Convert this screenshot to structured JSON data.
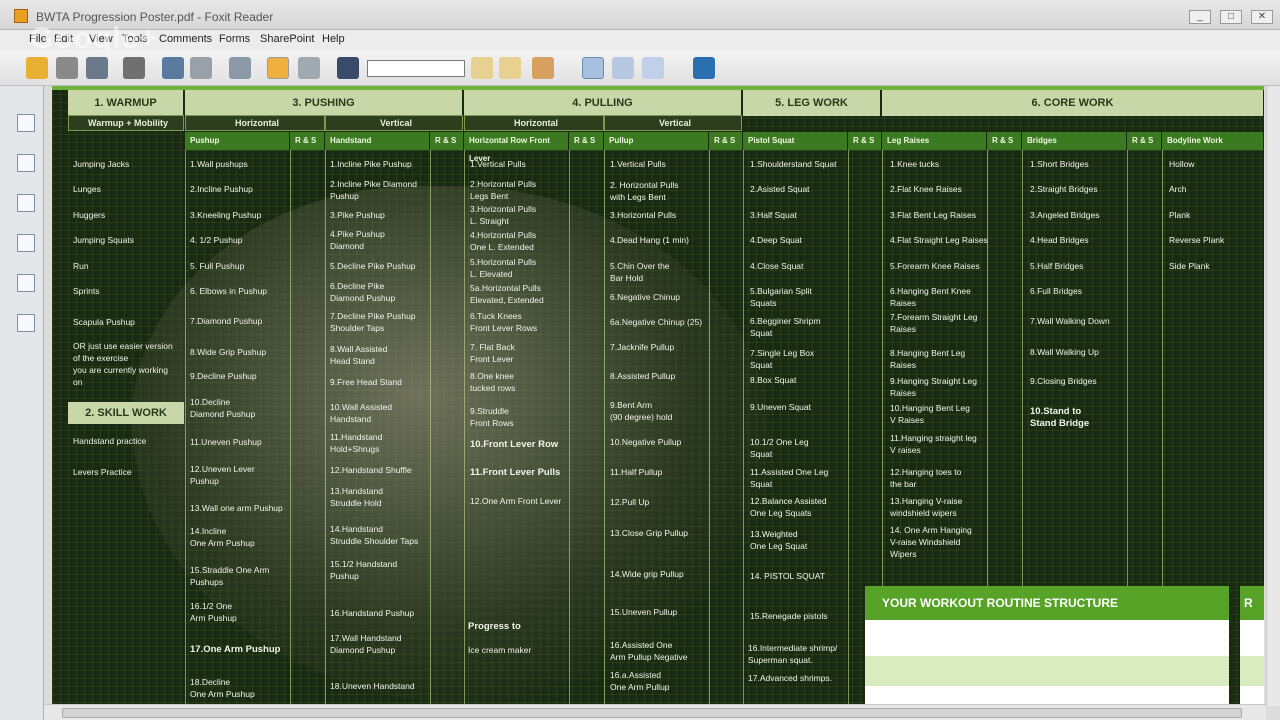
{
  "window": {
    "title": "BWTA Progression Poster.pdf - Foxit Reader",
    "min": "_",
    "max": "□",
    "close": "✕"
  },
  "menu": [
    "File",
    "Edit",
    "View",
    "Tools",
    "Comments",
    "Forms",
    "SharePoint",
    "Help"
  ],
  "overlay": "Google+",
  "search": {
    "value": ""
  },
  "poster": {
    "cat": {
      "warmup": "1. WARMUP",
      "pushing": "3. PUSHING",
      "pulling": "4. PULLING",
      "leg": "5. LEG WORK",
      "core": "6. CORE WORK"
    },
    "sub": {
      "wm": "Warmup + Mobility",
      "pushH": "Horizontal",
      "pushV": "Vertical",
      "pullH": "Horizontal",
      "pullV": "Vertical"
    },
    "col": {
      "pushup": "Pushup",
      "rs": "R & S",
      "handstand": "Handstand",
      "hrow": "Horizontal Row Front Lever",
      "pullup": "Pullup",
      "pistol": "Pistol Squat",
      "legraises": "Leg Raises",
      "bridges": "Bridges",
      "bodyline": "Bodyline Work"
    },
    "warmup": [
      "Jumping Jacks",
      "Lunges",
      "Huggers",
      "Jumping Squats",
      "Run",
      "Sprints",
      "Scapula Pushup",
      "OR just use easier version",
      "of the exercise",
      "you are currently working",
      "on"
    ],
    "skill": "2. SKILL WORK",
    "skillItems": [
      "Handstand practice",
      "Levers Practice"
    ],
    "pushup": [
      "1.Wall pushups",
      "2.Incline Pushup",
      "3.Kneeling Pushup",
      "4. 1/2 Pushup",
      "5. Full Pushup",
      "6. Elbows in Pushup",
      "7.Diamond Pushup",
      "8.Wide Grip Pushup",
      "9.Decline Pushup",
      "10.Decline",
      "Diamond Pushup",
      "11.Uneven Pushup",
      "12.Uneven Lever",
      "Pushup",
      "13.Wall one arm Pushup",
      "14.Incline",
      "One Arm Pushup",
      "15.Straddle One Arm",
      "Pushups",
      "16.1/2 One",
      "Arm Pushup",
      "17.One Arm Pushup",
      "18.Decline",
      "One Arm Pushup"
    ],
    "handstand": [
      "1.Incline Pike Pushup",
      "2.Incline Pike Diamond",
      "Pushup",
      "3.Pike Pushup",
      "4.Pike Pushup",
      "Diamond",
      "5.Decline Pike Pushup",
      "6.Decline Pike",
      "Diamond Pushup",
      "7.Decline Pike Pushup",
      "Shoulder Taps",
      "8.Wall Assisted",
      "Head Stand",
      "9.Free Head Stand",
      "10.Wall Assisted",
      "Handstand",
      "11.Handstand",
      "Hold+Shrugs",
      "12.Handstand Shuffle",
      "13.Handstand",
      "Struddle Hold",
      "14.Handstand",
      "Struddle Shoulder Taps",
      "15.1/2 Handstand",
      "Pushup",
      "16.Handstand Pushup",
      "17.Wall Handstand",
      "Diamond Pushup",
      "18.Uneven Handstand"
    ],
    "hrow": [
      "1.Vertical Pulls",
      "2.Horizontal Pulls",
      "Legs Bent",
      "3.Horizontal Pulls",
      "L. Straight",
      "4.Horizontal Pulls",
      "One L. Extended",
      "5.Horizontal Pulls",
      "L. Elevated",
      "5a.Horizontal Pulls",
      "Elevated, Extended",
      "6.Tuck Knees",
      "Front Lever Rows",
      "7. Flat Back",
      "Front Lever",
      "8.One knee",
      "tucked rows",
      "9.Struddle",
      "Front Rows",
      "10.Front Lever Row",
      "11.Front Lever Pulls",
      "12.One Arm Front Lever",
      "Progress to",
      "Ice cream maker"
    ],
    "pullup": [
      "1.Vertical Pulls",
      "2. Horizontal Pulls",
      "with Legs Bent",
      "3.Horizontal Pulls",
      "4.Dead Hang (1 min)",
      "5.Chin Over the",
      "Bar Hold",
      "6.Negative Chinup",
      "6a.Negative Chinup (25)",
      "7.Jacknife Pullup",
      "8.Assisted Pullup",
      "9.Bent Arm",
      "(90 degree) hold",
      "10.Negative Pullup",
      "11.Half Pullup",
      "12.Pull Up",
      "13.Close Grip Pullup",
      "14.Wide grip Pullup",
      "15.Uneven Pullup",
      "16.Assisted One",
      "Arm Pullup Negative",
      "16.a.Assisted",
      "One Arm Pullup"
    ],
    "pistol": [
      "1.Shoulderstand Squat",
      "2.Asisted Squat",
      "3.Half Squat",
      "4.Deep Squat",
      "4.Close Squat",
      "5.Bulgarian Split",
      "Squats",
      "6.Begginer Shripm",
      "Squat",
      "7.Single Leg Box",
      "Squat",
      "8.Box Squat",
      "9.Uneven Squat",
      "10.1/2 One Leg",
      "Squat",
      "11.Assisted One Leg",
      "Squat",
      "12.Balance Assisted",
      "One Leg Squats",
      "13.Weighted",
      "One Leg Squat",
      "14. PISTOL SQUAT",
      "15.Renegade pistols",
      "16.Intermediate shrimp/",
      "Superman squat.",
      "17.Advanced shrimps."
    ],
    "legraises": [
      "1.Knee tucks",
      "2.Flat Knee Raises",
      "3.Flat Bent Leg Raises",
      "4.Flat Straight Leg Raises",
      "5.Forearm Knee Raises",
      "6.Hanging Bent Knee",
      "Raises",
      "7.Forearm Straight Leg",
      "Raises",
      "8.Hanging Bent Leg",
      "Raises",
      "9.Hanging Straight Leg",
      "Raises",
      "10.Hanging Bent Leg",
      "V Raises",
      "11.Hanging straight leg",
      "V raises",
      "12.Hanging toes to",
      "the bar",
      "13.Hanging V-raise",
      "windshield wipers",
      "14. One Arm Hanging",
      "V-raise Windshield",
      "Wipers"
    ],
    "bridges": [
      "1.Short Bridges",
      "2.Straight Bridges",
      "3.Angeled Bridges",
      "4.Head Bridges",
      "5.Half Bridges",
      "6.Full Bridges",
      "7.Wall Walking Down",
      "8.Wall Walking Up",
      "9.Closing Bridges",
      "10.Stand to",
      "Stand Bridge"
    ],
    "bodyline": [
      "Hollow",
      "Arch",
      "Plank",
      "Reverse Plank",
      "Side Plank"
    ],
    "routine": "YOUR WORKOUT ROUTINE STRUCTURE",
    "routine2": "R"
  }
}
